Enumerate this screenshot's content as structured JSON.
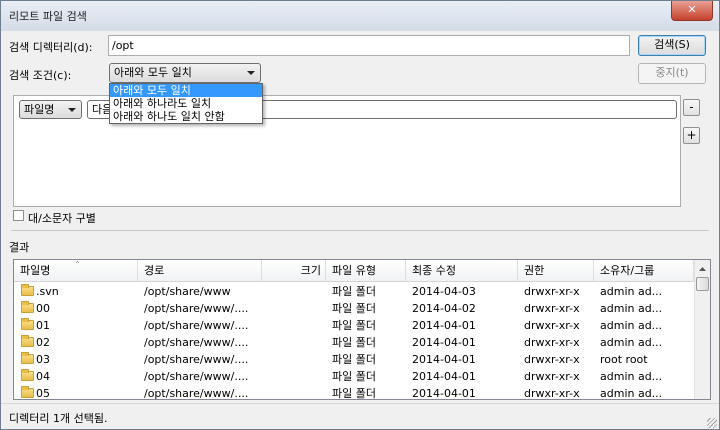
{
  "window": {
    "title": "리모트 파일 검색",
    "close_label": "✕"
  },
  "search_dir": {
    "label": "검색 디렉터리(d):",
    "value": "/opt"
  },
  "search_button": "검색(S)",
  "stop_button": "중지(t)",
  "condition": {
    "label": "검색 조건(c):",
    "selected": "아래와 모두 일치",
    "options": [
      "아래와 모두 일치",
      "아래와 하나라도 일치",
      "아래와 하나도 일치 안함"
    ]
  },
  "rule": {
    "field": "파일명",
    "op": "다음"
  },
  "remove_rule": "-",
  "add_rule": "+",
  "case_sensitive": {
    "label": "대/소문자 구별",
    "checked": false
  },
  "results_label": "결과",
  "columns": [
    "파일명",
    "경로",
    "크기",
    "파일 유형",
    "최종 수정",
    "권한",
    "소유자/그룹"
  ],
  "rows": [
    {
      "name": ".svn",
      "path": "/opt/share/www",
      "size": "",
      "type": "파일 폴더",
      "modified": "2014-04-03",
      "perm": "drwxr-xr-x",
      "owner": "admin ad..."
    },
    {
      "name": "00",
      "path": "/opt/share/www/....",
      "size": "",
      "type": "파일 폴더",
      "modified": "2014-04-02",
      "perm": "drwxr-xr-x",
      "owner": "admin ad..."
    },
    {
      "name": "01",
      "path": "/opt/share/www/....",
      "size": "",
      "type": "파일 폴더",
      "modified": "2014-04-01",
      "perm": "drwxr-xr-x",
      "owner": "admin ad..."
    },
    {
      "name": "02",
      "path": "/opt/share/www/....",
      "size": "",
      "type": "파일 폴더",
      "modified": "2014-04-01",
      "perm": "drwxr-xr-x",
      "owner": "admin ad..."
    },
    {
      "name": "03",
      "path": "/opt/share/www/....",
      "size": "",
      "type": "파일 폴더",
      "modified": "2014-04-01",
      "perm": "drwxr-xr-x",
      "owner": "root root"
    },
    {
      "name": "04",
      "path": "/opt/share/www/....",
      "size": "",
      "type": "파일 폴더",
      "modified": "2014-04-01",
      "perm": "drwxr-xr-x",
      "owner": "admin ad..."
    },
    {
      "name": "05",
      "path": "/opt/share/www/....",
      "size": "",
      "type": "파일 폴더",
      "modified": "2014-04-01",
      "perm": "drwxr-xr-x",
      "owner": "admin ad..."
    }
  ],
  "status": "디렉터리 1개 선택됨.",
  "icons": {
    "folder": "folder-icon",
    "sort": "sort-ascending-icon",
    "close": "close-icon",
    "dropdown": "chevron-down-icon"
  }
}
